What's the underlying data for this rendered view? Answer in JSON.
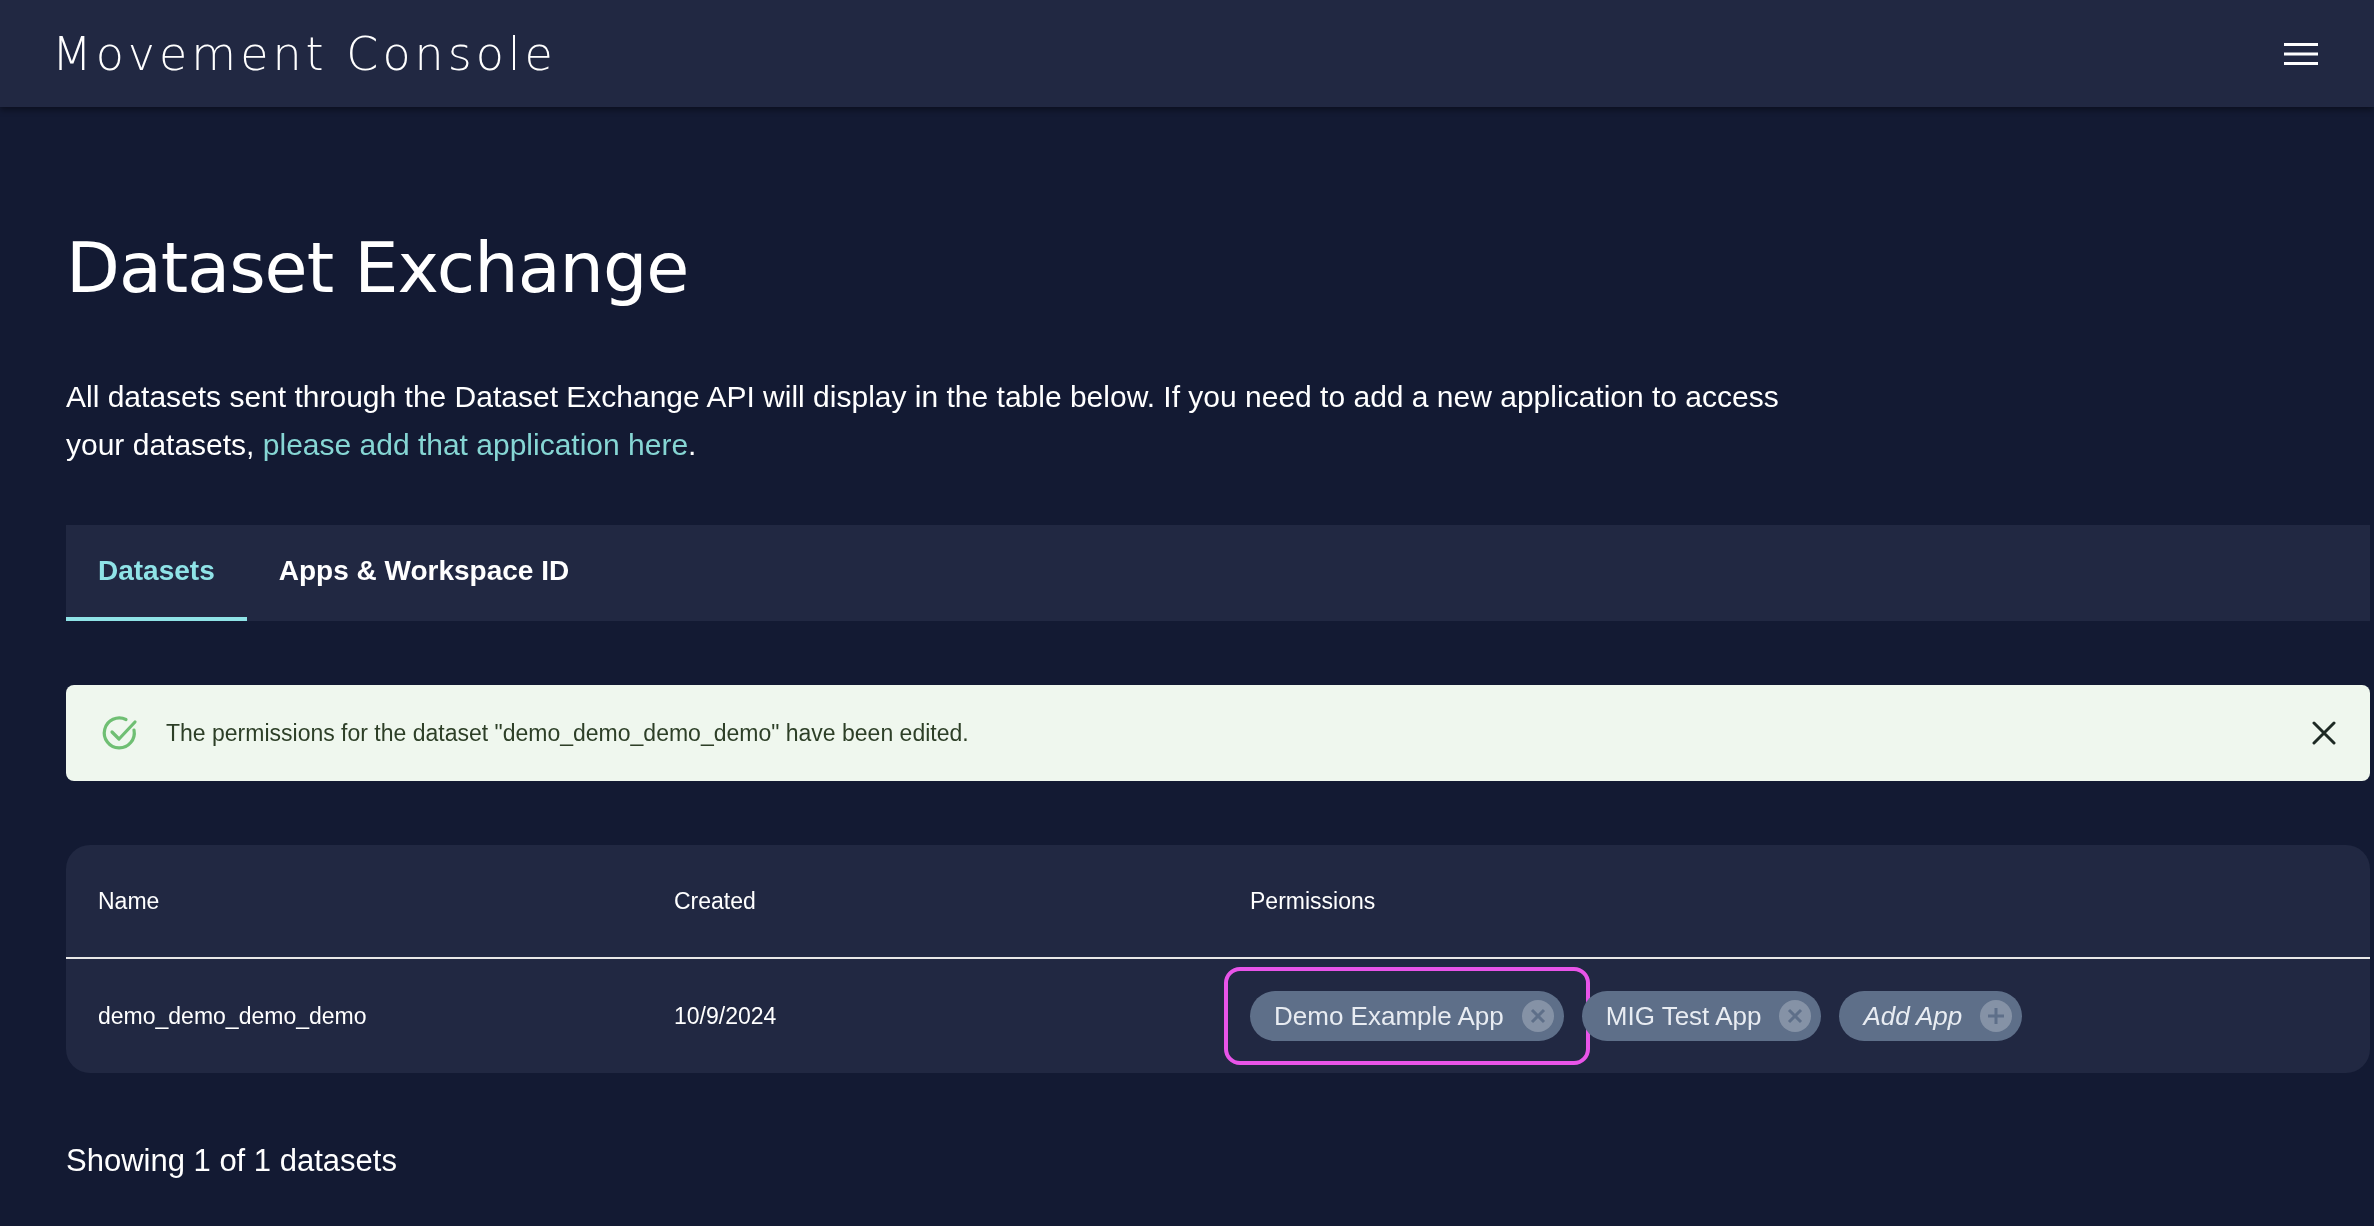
{
  "header": {
    "title": "Movement Console"
  },
  "page": {
    "heading": "Dataset Exchange",
    "intro": "All datasets sent through the Dataset Exchange API will display in the table below. If you need to add a new application to access your datasets, ",
    "intro_link": "please add that application here",
    "intro_end": "."
  },
  "tabs": [
    {
      "label": "Datasets",
      "selected": true
    },
    {
      "label": "Apps & Workspace ID",
      "selected": false
    }
  ],
  "alert": {
    "kind": "success",
    "message": "The permissions for the dataset \"demo_demo_demo_demo\" have been edited."
  },
  "table": {
    "columns": [
      "Name",
      "Created",
      "Permissions"
    ],
    "rows": [
      {
        "name": "demo_demo_demo_demo",
        "created": "10/9/2024",
        "permissions": [
          {
            "label": "Demo Example App",
            "kind": "app",
            "highlighted": true
          },
          {
            "label": "MIG Test App",
            "kind": "app",
            "highlighted": false
          },
          {
            "label": "Add App",
            "kind": "add",
            "highlighted": false
          }
        ]
      }
    ]
  },
  "footer": {
    "count": "Showing 1 of 1 datasets"
  }
}
